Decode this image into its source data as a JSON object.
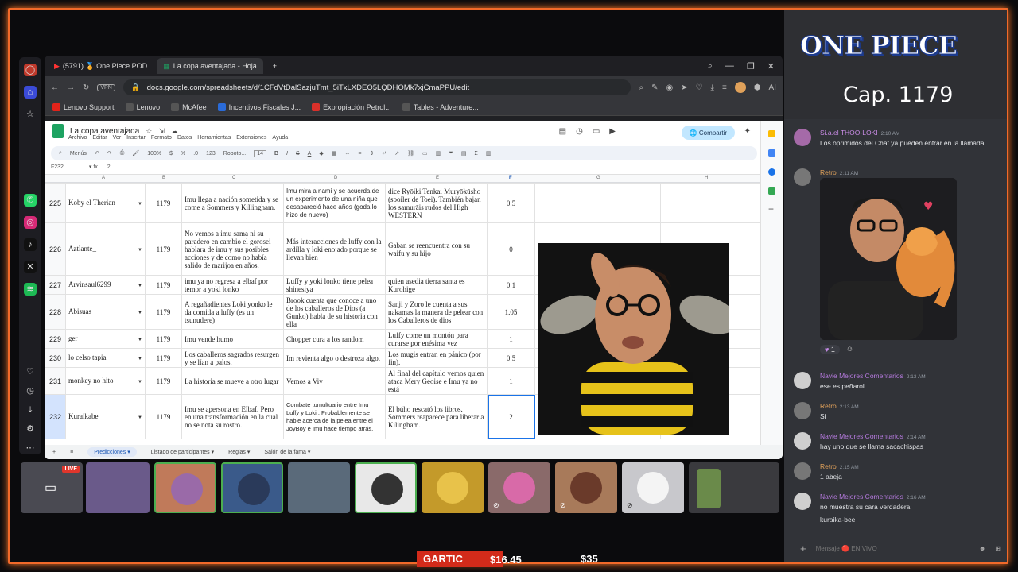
{
  "browser": {
    "tabs": [
      {
        "label": "(5791) 🏅 One Piece POD"
      },
      {
        "label": "La copa aventajada - Hoja"
      }
    ],
    "url": "docs.google.com/spreadsheets/d/1CFdVtDalSazjuTmt_5iTxLXDEO5LQDHOMk7xjCmaPPU/edit",
    "vpn": "VPN",
    "bookmarks": [
      "Lenovo Support",
      "Lenovo",
      "McAfee",
      "Incentivos Fiscales J...",
      "Expropiación Petrol...",
      "Tables - Adventure..."
    ]
  },
  "sheet": {
    "title": "La copa aventajada",
    "menu": [
      "Archivo",
      "Editar",
      "Ver",
      "Insertar",
      "Formato",
      "Datos",
      "Herramientas",
      "Extensiones",
      "Ayuda"
    ],
    "share_label": "Compartir",
    "toolbar": {
      "menus": "Menús",
      "zoom": "100%",
      "font": "Roboto...",
      "size": "14",
      "format_123": "123"
    },
    "cell_ref": "F232",
    "formula": "2",
    "col_headers": [
      "A",
      "B",
      "C",
      "D",
      "E",
      "F",
      "G",
      "H"
    ],
    "rows": [
      {
        "num": "225",
        "name": "Koby el Therian",
        "chapter": "1179",
        "c1": "Imu llega a nación sometida y se come a Sommers y Killingham.",
        "c2": "Imu mira a nami y se acuerda de un experimento de una niña que desapareció hace años (goda lo hizo de nuevo)",
        "c3": "dice Ryōiki Tenkai Muryōkūsho (spoiler de Toei). También bajan los samurāis rudos del High WESTERN",
        "points": "0.5"
      },
      {
        "num": "226",
        "name": "Aztlante_",
        "chapter": "1179",
        "c1": "No vemos a imu sama ni su paradero en cambio el gorosei hablara de imu y sus posibles acciones y de como no había salido de marijoa en años.",
        "c2": "Más interacciones de luffy con la ardilla y loki enojado porque se llevan bien",
        "c3": "Gaban se reencuentra con su waifu y su hijo",
        "points": "0"
      },
      {
        "num": "227",
        "name": "Arvinsaul6299",
        "chapter": "1179",
        "c1": "imu ya no regresa a elbaf por temor a yoki lonko",
        "c2": "Luffy y yoki lonko tiene pelea shinesiya",
        "c3": "quien asedia tierra santa es Kurohige",
        "points": "0.1"
      },
      {
        "num": "228",
        "name": "Abisuas",
        "chapter": "1179",
        "c1": "A regañadientes Loki yonko le da comida a luffy (es un tsunudere)",
        "c2": "Brook cuenta que conoce a uno de los caballeros de Dios (a Gunko) habla de su historia con ella",
        "c3": "Sanji y Zoro le cuenta a sus nakamas la manera de pelear con los Caballeros de dios",
        "points": "1.05"
      },
      {
        "num": "229",
        "name": "ger",
        "chapter": "1179",
        "c1": "Imu vende humo",
        "c2": "Chopper cura a los random",
        "c3": "Luffy come un montón para curarse por enésima vez",
        "points": "1"
      },
      {
        "num": "230",
        "name": "lo celso tapia",
        "chapter": "1179",
        "c1": "Los caballeros sagrados resurgen y se lían a palos.",
        "c2": "Im revienta algo o destroza algo.",
        "c3": "Los mugis entran en pánico (por fin).",
        "points": "0.5"
      },
      {
        "num": "231",
        "name": "monkey no hito",
        "chapter": "1179",
        "c1": "La historia se mueve a otro lugar",
        "c2": "Vemos a Viv",
        "c3": "Al final del capítulo vemos quien ataca Mery Geoise e Imu ya no está",
        "points": "1"
      },
      {
        "num": "232",
        "name": "Kuraikabe",
        "chapter": "1179",
        "c1": "Imu se apersona en Elbaf. Pero en una transformación en la cual no se nota su rostro.",
        "c2": "Combate tumultuario entre Imu , Luffy y Loki . Probablemente se hable acerca de la pelea entre el JoyBoy e Imu hace tiempo atrás.",
        "c3": "El búho rescató los libros. Sommers reaparece para liberar a Kilingham.",
        "points": "2"
      }
    ],
    "sheet_tabs": [
      "Predicciones",
      "Listado de participantes",
      "Reglas",
      "Salón de la fama"
    ]
  },
  "overlay": {
    "logo_title": "ONE PIECE",
    "chapter": "Cap. 1179",
    "gartic_label": "GARTIC",
    "gartic_amount": "$16.45",
    "amount2": "$35",
    "live_badge": "LIVE"
  },
  "chat": {
    "messages": [
      {
        "name": "Si.a.el THOO-LOKI",
        "time": "2:10 AM",
        "text": "Los oprimidos del Chat ya pueden entrar en la llamada",
        "color": "#c98ce6"
      },
      {
        "name": "Retro",
        "time": "2:11 AM",
        "text": "",
        "color": "#e0a15a"
      },
      {
        "name": "Navie Mejores Comentarios",
        "time": "2:13 AM",
        "text": "ese es peñarol",
        "color": "#b77be0"
      },
      {
        "name": "Retro",
        "time": "2:13 AM",
        "text": "Si",
        "color": "#e0a15a"
      },
      {
        "name": "Navie Mejores Comentarios",
        "time": "2:14 AM",
        "text": "hay uno que se llama sacachispas",
        "color": "#b77be0"
      },
      {
        "name": "Retro",
        "time": "2:15 AM",
        "text": "1 abeja",
        "color": "#e0a15a"
      },
      {
        "name": "Navie Mejores Comentarios",
        "time": "2:16 AM",
        "text": "no muestra su cara verdadera",
        "color": "#b77be0"
      }
    ],
    "extra_line": "kuraika-bee",
    "reaction_count": "1",
    "input_placeholder": "Mensaje 🔴 EN VIVO"
  }
}
